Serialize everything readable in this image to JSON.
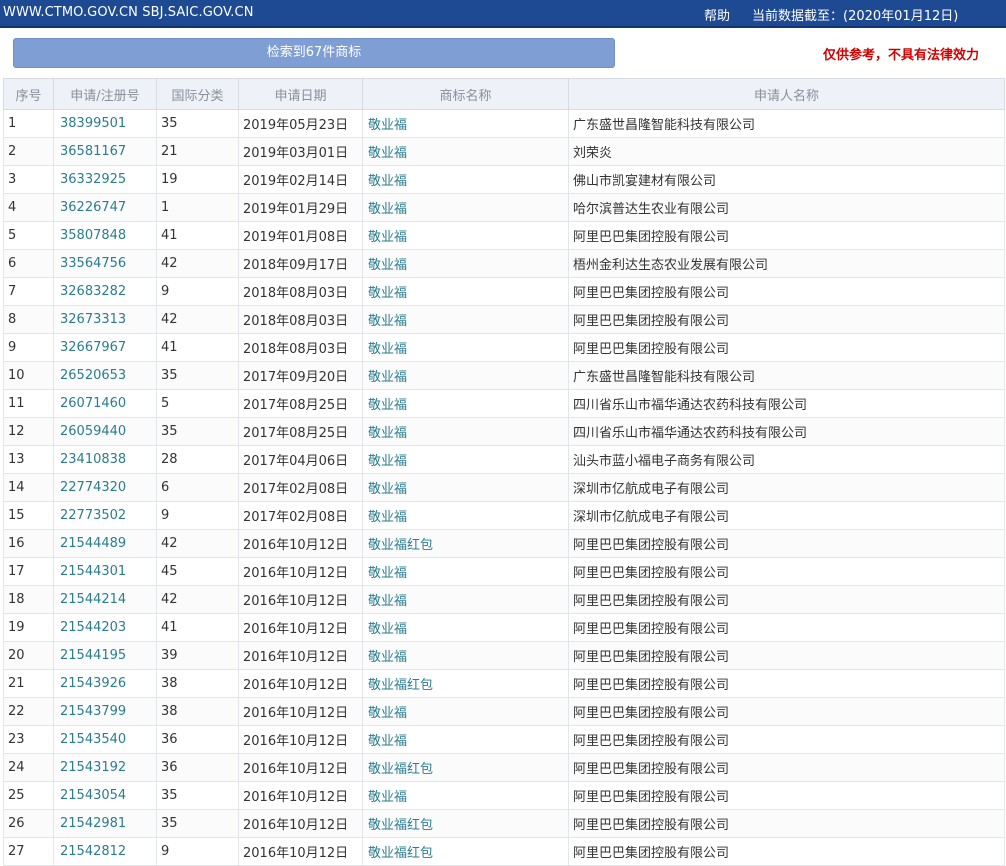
{
  "header": {
    "site_text": "WWW.CTMO.GOV.CN SBJ.SAIC.GOV.CN",
    "help_label": "帮助",
    "date_info": "当前数据截至：(2020年01月12日)"
  },
  "search": {
    "result_label": "检索到67件商标",
    "disclaimer": "仅供参考，不具有法律效力"
  },
  "table": {
    "columns": [
      "序号",
      "申请/注册号",
      "国际分类",
      "申请日期",
      "商标名称",
      "申请人名称"
    ],
    "rows": [
      {
        "no": "1",
        "reg": "38399501",
        "cls": "35",
        "date": "2019年05月23日",
        "name": "敬业福",
        "applicant": "广东盛世昌隆智能科技有限公司"
      },
      {
        "no": "2",
        "reg": "36581167",
        "cls": "21",
        "date": "2019年03月01日",
        "name": "敬业福",
        "applicant": "刘荣炎"
      },
      {
        "no": "3",
        "reg": "36332925",
        "cls": "19",
        "date": "2019年02月14日",
        "name": "敬业福",
        "applicant": "佛山市凯宴建材有限公司"
      },
      {
        "no": "4",
        "reg": "36226747",
        "cls": "1",
        "date": "2019年01月29日",
        "name": "敬业福",
        "applicant": "哈尔滨普达生农业有限公司"
      },
      {
        "no": "5",
        "reg": "35807848",
        "cls": "41",
        "date": "2019年01月08日",
        "name": "敬业福",
        "applicant": "阿里巴巴集团控股有限公司"
      },
      {
        "no": "6",
        "reg": "33564756",
        "cls": "42",
        "date": "2018年09月17日",
        "name": "敬业福",
        "applicant": "梧州金利达生态农业发展有限公司"
      },
      {
        "no": "7",
        "reg": "32683282",
        "cls": "9",
        "date": "2018年08月03日",
        "name": "敬业福",
        "applicant": "阿里巴巴集团控股有限公司"
      },
      {
        "no": "8",
        "reg": "32673313",
        "cls": "42",
        "date": "2018年08月03日",
        "name": "敬业福",
        "applicant": "阿里巴巴集团控股有限公司"
      },
      {
        "no": "9",
        "reg": "32667967",
        "cls": "41",
        "date": "2018年08月03日",
        "name": "敬业福",
        "applicant": "阿里巴巴集团控股有限公司"
      },
      {
        "no": "10",
        "reg": "26520653",
        "cls": "35",
        "date": "2017年09月20日",
        "name": "敬业福",
        "applicant": "广东盛世昌隆智能科技有限公司"
      },
      {
        "no": "11",
        "reg": "26071460",
        "cls": "5",
        "date": "2017年08月25日",
        "name": "敬业福",
        "applicant": "四川省乐山市福华通达农药科技有限公司"
      },
      {
        "no": "12",
        "reg": "26059440",
        "cls": "35",
        "date": "2017年08月25日",
        "name": "敬业福",
        "applicant": "四川省乐山市福华通达农药科技有限公司"
      },
      {
        "no": "13",
        "reg": "23410838",
        "cls": "28",
        "date": "2017年04月06日",
        "name": "敬业福",
        "applicant": "汕头市蓝小福电子商务有限公司"
      },
      {
        "no": "14",
        "reg": "22774320",
        "cls": "6",
        "date": "2017年02月08日",
        "name": "敬业福",
        "applicant": "深圳市亿航成电子有限公司"
      },
      {
        "no": "15",
        "reg": "22773502",
        "cls": "9",
        "date": "2017年02月08日",
        "name": "敬业福",
        "applicant": "深圳市亿航成电子有限公司"
      },
      {
        "no": "16",
        "reg": "21544489",
        "cls": "42",
        "date": "2016年10月12日",
        "name": "敬业福红包",
        "applicant": "阿里巴巴集团控股有限公司"
      },
      {
        "no": "17",
        "reg": "21544301",
        "cls": "45",
        "date": "2016年10月12日",
        "name": "敬业福",
        "applicant": "阿里巴巴集团控股有限公司"
      },
      {
        "no": "18",
        "reg": "21544214",
        "cls": "42",
        "date": "2016年10月12日",
        "name": "敬业福",
        "applicant": "阿里巴巴集团控股有限公司"
      },
      {
        "no": "19",
        "reg": "21544203",
        "cls": "41",
        "date": "2016年10月12日",
        "name": "敬业福",
        "applicant": "阿里巴巴集团控股有限公司"
      },
      {
        "no": "20",
        "reg": "21544195",
        "cls": "39",
        "date": "2016年10月12日",
        "name": "敬业福",
        "applicant": "阿里巴巴集团控股有限公司"
      },
      {
        "no": "21",
        "reg": "21543926",
        "cls": "38",
        "date": "2016年10月12日",
        "name": "敬业福红包",
        "applicant": "阿里巴巴集团控股有限公司"
      },
      {
        "no": "22",
        "reg": "21543799",
        "cls": "38",
        "date": "2016年10月12日",
        "name": "敬业福",
        "applicant": "阿里巴巴集团控股有限公司"
      },
      {
        "no": "23",
        "reg": "21543540",
        "cls": "36",
        "date": "2016年10月12日",
        "name": "敬业福",
        "applicant": "阿里巴巴集团控股有限公司"
      },
      {
        "no": "24",
        "reg": "21543192",
        "cls": "36",
        "date": "2016年10月12日",
        "name": "敬业福红包",
        "applicant": "阿里巴巴集团控股有限公司"
      },
      {
        "no": "25",
        "reg": "21543054",
        "cls": "35",
        "date": "2016年10月12日",
        "name": "敬业福",
        "applicant": "阿里巴巴集团控股有限公司"
      },
      {
        "no": "26",
        "reg": "21542981",
        "cls": "35",
        "date": "2016年10月12日",
        "name": "敬业福红包",
        "applicant": "阿里巴巴集团控股有限公司"
      },
      {
        "no": "27",
        "reg": "21542812",
        "cls": "9",
        "date": "2016年10月12日",
        "name": "敬业福红包",
        "applicant": "阿里巴巴集团控股有限公司"
      }
    ]
  }
}
